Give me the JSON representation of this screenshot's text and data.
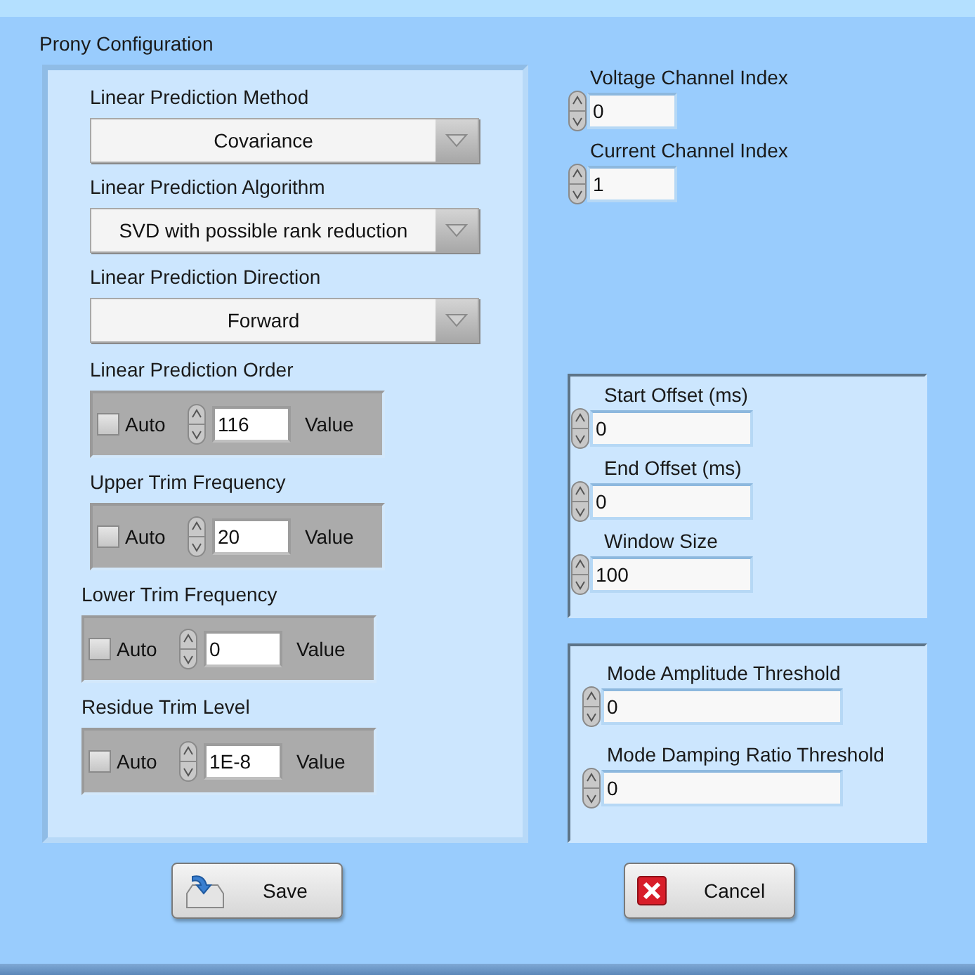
{
  "title": "Prony Configuration",
  "dropdowns": [
    {
      "label": "Linear Prediction Method",
      "value": "Covariance"
    },
    {
      "label": "Linear Prediction Algorithm",
      "value": "SVD with possible rank reduction"
    },
    {
      "label": "Linear Prediction Direction",
      "value": "Forward"
    }
  ],
  "clusters": [
    {
      "label": "Linear Prediction Order",
      "checkbox_label": "Auto",
      "checked": false,
      "value": "116",
      "value_label": "Value"
    },
    {
      "label": "Upper Trim Frequency",
      "checkbox_label": "Auto",
      "checked": false,
      "value": "20",
      "value_label": "Value"
    },
    {
      "label": "Lower Trim Frequency",
      "checkbox_label": "Auto",
      "checked": false,
      "value": "0",
      "value_label": "Value"
    },
    {
      "label": "Residue Trim Level",
      "checkbox_label": "Auto",
      "checked": false,
      "value": "1E-8",
      "value_label": "Value"
    }
  ],
  "channels": [
    {
      "label": "Voltage Channel Index",
      "value": "0"
    },
    {
      "label": "Current Channel Index",
      "value": "1"
    }
  ],
  "offsets": [
    {
      "label": "Start Offset (ms)",
      "value": "0"
    },
    {
      "label": "End Offset (ms)",
      "value": "0"
    },
    {
      "label": "Window Size",
      "value": "100"
    }
  ],
  "thresholds": [
    {
      "label": "Mode Amplitude Threshold",
      "value": "0"
    },
    {
      "label": "Mode Damping Ratio Threshold",
      "value": "0"
    }
  ],
  "buttons": [
    {
      "kind": "save",
      "label": "Save"
    },
    {
      "kind": "cancel",
      "label": "Cancel"
    }
  ]
}
